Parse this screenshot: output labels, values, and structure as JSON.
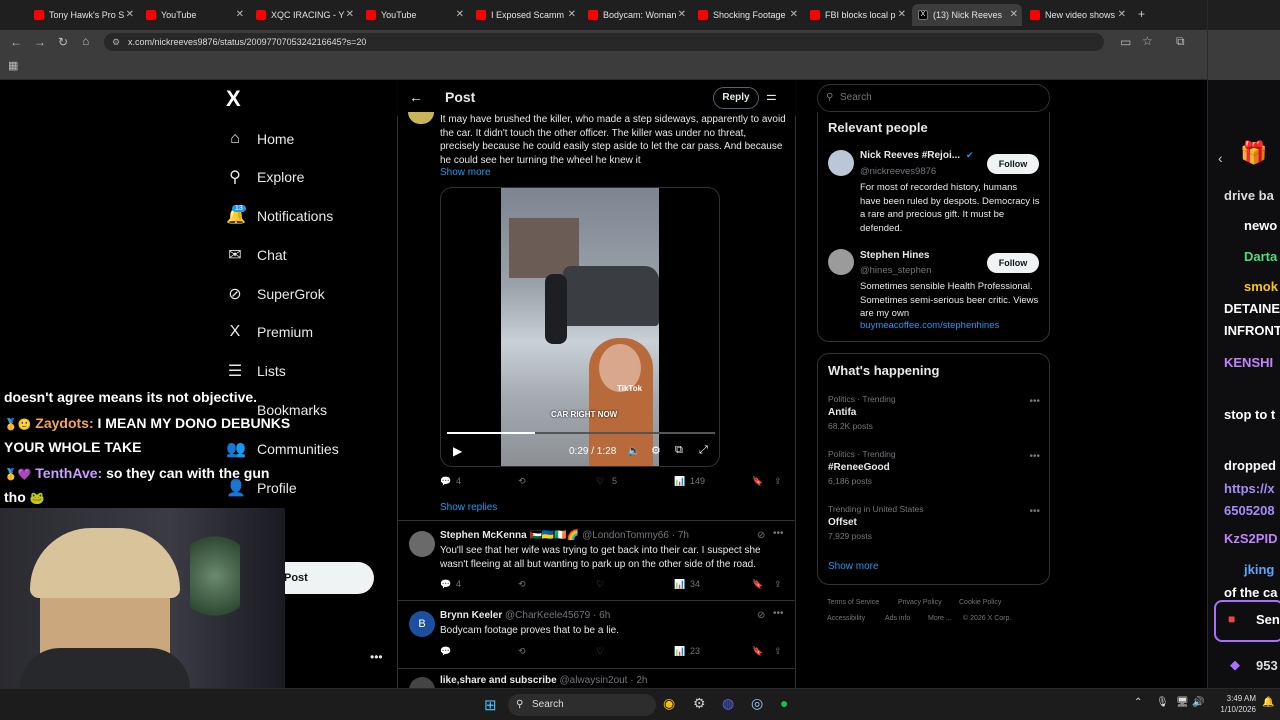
{
  "browser": {
    "tabs": [
      {
        "label": "Tony Hawk's Pro S",
        "icon": "youtube-icon"
      },
      {
        "label": "YouTube",
        "icon": "youtube-icon"
      },
      {
        "label": "XQC IRACING - Y",
        "icon": "youtube-icon"
      },
      {
        "label": "YouTube",
        "icon": "youtube-icon"
      },
      {
        "label": "I Exposed Scamm",
        "icon": "youtube-icon"
      },
      {
        "label": "Bodycam: Woman",
        "icon": "youtube-icon"
      },
      {
        "label": "Shocking Footage",
        "icon": "youtube-icon"
      },
      {
        "label": "FBI blocks local p",
        "icon": "youtube-icon"
      },
      {
        "label": "(13) Nick Reeves",
        "icon": "x-icon"
      },
      {
        "label": "New video shows",
        "icon": "youtube-icon"
      }
    ],
    "new_tab": "+",
    "url": "x.com/nickreeves9876/status/2009770705324216645?s=20"
  },
  "x_nav": {
    "logo": "X",
    "items": [
      {
        "label": "Home",
        "icon": "home-icon",
        "glyph": "⌂"
      },
      {
        "label": "Explore",
        "icon": "search-icon",
        "glyph": "⚲"
      },
      {
        "label": "Notifications",
        "icon": "bell-icon",
        "glyph": "🔔"
      },
      {
        "label": "Chat",
        "icon": "mail-icon",
        "glyph": "✉"
      },
      {
        "label": "SuperGrok",
        "icon": "grok-icon",
        "glyph": "⊘"
      },
      {
        "label": "Premium",
        "icon": "x-premium-icon",
        "glyph": "X"
      },
      {
        "label": "Lists",
        "icon": "lists-icon",
        "glyph": "☰"
      },
      {
        "label": "Bookmarks",
        "icon": "bookmark-icon",
        "glyph": ""
      },
      {
        "label": "Communities",
        "icon": "communities-icon",
        "glyph": "👥"
      },
      {
        "label": "Profile",
        "icon": "profile-icon",
        "glyph": "👤"
      }
    ],
    "notif_count": "13",
    "post_button": "Post"
  },
  "post": {
    "header_title": "Post",
    "reply_button": "Reply",
    "body": "It may have brushed the killer, who made a step sideways, apparently to avoid the car. It didn't touch the other officer. The killer was under no threat, precisely because he could easily step aside to let the car pass. And because he could see her turning the wheel he knew it",
    "show_more": "Show more",
    "video": {
      "caption": "CAR RIGHT NOW",
      "watermark": "TikTok",
      "time": "0:29 / 1:28",
      "progress": 0.33
    },
    "stats": {
      "replies": "4",
      "retweets": "",
      "likes": "5",
      "views": "149"
    },
    "show_replies": "Show replies"
  },
  "replies": [
    {
      "name": "Stephen McKenna",
      "flags": "🇵🇸🇺🇦🇮🇪🌈",
      "handle": "@LondonTommy66",
      "time": "· 7h",
      "text": "You'll see that her wife was trying to get back into their car. I suspect she wasn't fleeing at all but wanting to park up on the other side of the road.",
      "replies": "4",
      "likes": "",
      "views": "34"
    },
    {
      "name": "Brynn Keeler",
      "handle": "@CharKeele45679",
      "time": "· 6h",
      "text": "Bodycam footage proves that to be a lie.",
      "avatar_letter": "B",
      "replies": "",
      "likes": "",
      "views": "23"
    },
    {
      "name": "like,share and subscribe",
      "handle": "@alwaysin2out",
      "time": "· 2h"
    }
  ],
  "right": {
    "search_placeholder": "Search",
    "relevant_title": "Relevant people",
    "people": [
      {
        "name": "Nick Reeves #Rejoi...",
        "handle": "@nickreeves9876",
        "bio": "For most of recorded history, humans have been ruled by despots. Democracy is a rare and precious gift. It must be defended.",
        "follow": "Follow"
      },
      {
        "name": "Stephen Hines",
        "handle": "@hines_stephen",
        "bio": "Sometimes sensible Health Professional. Sometimes semi-serious beer critic. Views are my own",
        "link": "buymeacoffee.com/stephenhines",
        "follow": "Follow"
      }
    ],
    "happening_title": "What's happening",
    "trends": [
      {
        "context": "Politics · Trending",
        "topic": "Antifa",
        "posts": "68.2K posts"
      },
      {
        "context": "Politics · Trending",
        "topic": "#ReneeGood",
        "posts": "6,186 posts"
      },
      {
        "context": "Trending in United States",
        "topic": "Offset",
        "posts": "7,929 posts"
      }
    ],
    "show_more": "Show more",
    "footer": [
      "Terms of Service",
      "Privacy Policy",
      "Cookie Policy",
      "Accessibility",
      "Ads info",
      "More ...",
      "© 2026 X Corp."
    ]
  },
  "chat_overlay": {
    "line1": "doesn't agree means its not objective.",
    "user1": "Zaydots:",
    "msg1a": "I MEAN MY DONO DEBUNKS",
    "msg1b": "YOUR WHOLE TAKE",
    "user2": "TenthAve:",
    "msg2a": "so they can with the gun",
    "msg2b": "tho"
  },
  "right_chat": {
    "lines": [
      "drive ba",
      "newo",
      "Darta",
      "smok",
      "DETAINE",
      "INFRONT",
      "KENSHI",
      "stop to t",
      "dropped",
      "https://x",
      "6505208",
      "KzS2PID",
      "jking",
      "of the ca",
      "Sen",
      "953"
    ]
  },
  "taskbar": {
    "search": "Search",
    "time": "3:49 AM",
    "date": "1/10/2026"
  },
  "colors": {
    "accent": "#1d9bf0",
    "bg": "#000000",
    "border": "#2f3336",
    "muted": "#71767b"
  }
}
